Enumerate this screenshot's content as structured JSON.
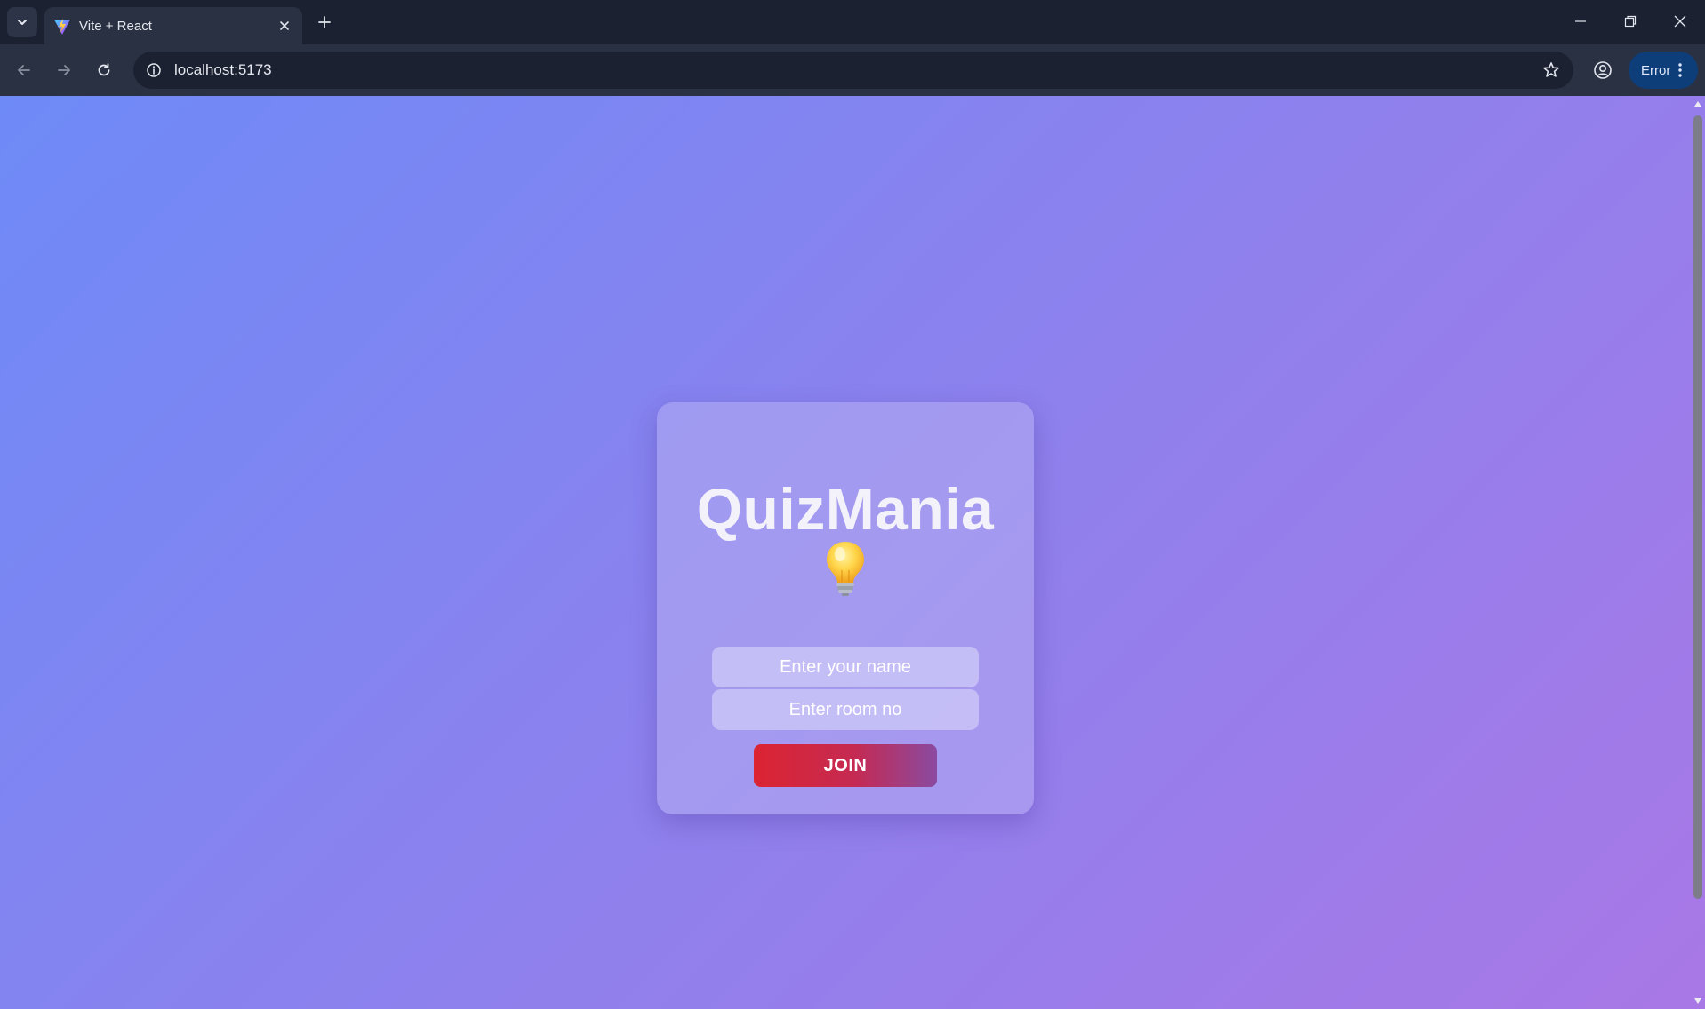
{
  "browser": {
    "tab": {
      "title": "Vite + React",
      "favicon": "vite-logo-icon"
    },
    "address_bar": {
      "url": "localhost:5173"
    },
    "profile_status": {
      "label": "Error"
    },
    "icons": {
      "tab_menu": "chevron-down-icon",
      "new_tab": "plus-icon",
      "back": "arrow-left-icon",
      "forward": "arrow-right-icon",
      "reload": "reload-icon",
      "site_info": "info-icon",
      "bookmark": "star-icon",
      "profile": "profile-icon",
      "menu": "kebab-menu-icon",
      "minimize": "minimize-icon",
      "restore": "restore-icon",
      "close": "close-icon"
    },
    "colors": {
      "chrome_dark": "#1b2131",
      "chrome_toolbar": "#2a3142",
      "error_pill": "#0e3e7a"
    }
  },
  "page": {
    "title": "QuizMania",
    "icon": "lightbulb-icon",
    "form": {
      "name_placeholder": "Enter your name",
      "name_value": "",
      "room_placeholder": "Enter room no",
      "room_value": "",
      "join_label": "JOIN"
    },
    "colors": {
      "background_start": "#6e8af7",
      "background_end": "#a878e6",
      "join_start": "#dc2432",
      "join_end": "#8a4aa0"
    }
  }
}
